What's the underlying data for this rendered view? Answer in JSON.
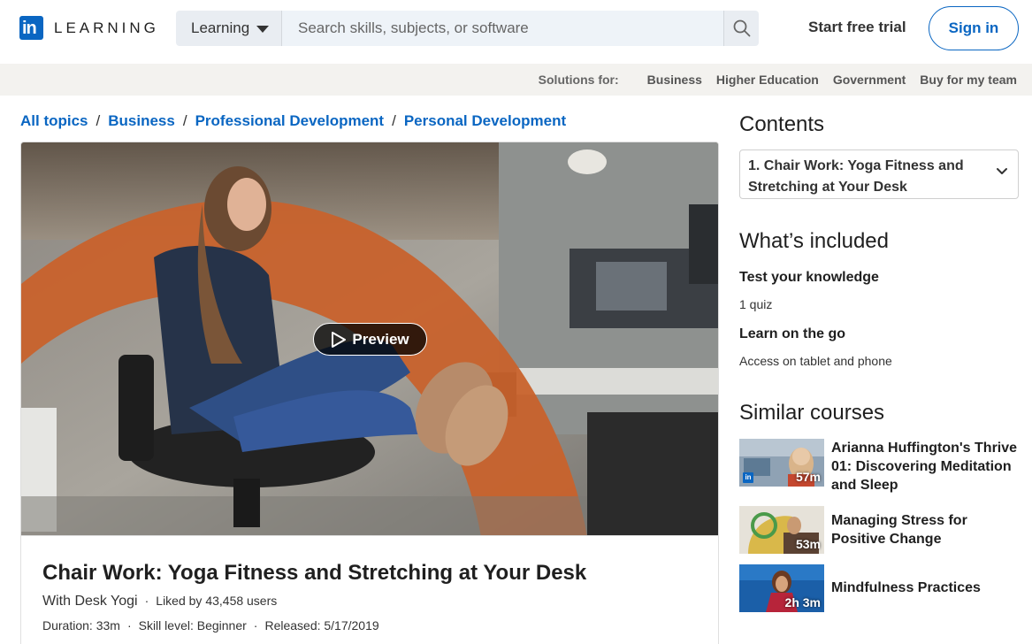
{
  "header": {
    "logo_word": "LEARNING",
    "logo_mark": "in",
    "search_select": "Learning",
    "search_placeholder": "Search skills, subjects, or software",
    "start_trial": "Start free trial",
    "sign_in": "Sign in"
  },
  "solutions": {
    "label": "Solutions for:",
    "items": [
      "Business",
      "Higher Education",
      "Government",
      "Buy for my team"
    ]
  },
  "breadcrumb": [
    "All topics",
    "Business",
    "Professional Development",
    "Personal Development"
  ],
  "hero": {
    "preview_label": "Preview"
  },
  "course": {
    "title": "Chair Work: Yoga Fitness and Stretching at Your Desk",
    "author": "With Desk Yogi",
    "likes": "Liked by 43,458 users",
    "duration": "Duration: 33m",
    "skill": "Skill level: Beginner",
    "released": "Released: 5/17/2019"
  },
  "contents": {
    "heading": "Contents",
    "chapter": "1. Chair Work: Yoga Fitness and Stretching at Your Desk"
  },
  "included": {
    "heading": "What’s included",
    "items": [
      {
        "title": "Test your knowledge",
        "sub": "1 quiz"
      },
      {
        "title": "Learn on the go",
        "sub": "Access on tablet and phone"
      }
    ]
  },
  "similar": {
    "heading": "Similar courses",
    "items": [
      {
        "title": "Arianna Huffington's Thrive 01: Discovering Meditation and Sleep",
        "duration": "57m"
      },
      {
        "title": "Managing Stress for Positive Change",
        "duration": "53m"
      },
      {
        "title": "Mindfulness Practices",
        "duration": "2h 3m"
      }
    ]
  },
  "colors": {
    "brand": "#0a66c2",
    "accent_orange": "#c8622c"
  }
}
